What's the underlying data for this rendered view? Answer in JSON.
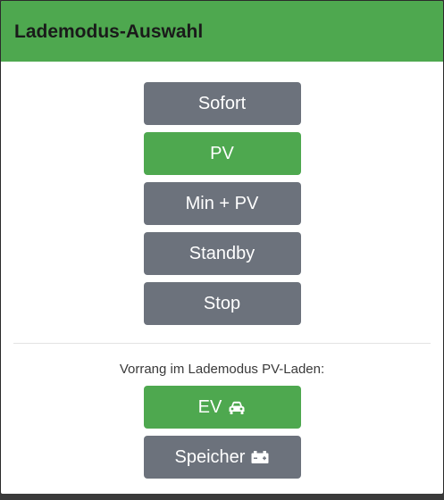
{
  "header": {
    "title": "Lademodus-Auswahl"
  },
  "modes": [
    {
      "label": "Sofort",
      "state": "inactive"
    },
    {
      "label": "PV",
      "state": "active"
    },
    {
      "label": "Min + PV",
      "state": "inactive"
    },
    {
      "label": "Standby",
      "state": "inactive"
    },
    {
      "label": "Stop",
      "state": "inactive"
    }
  ],
  "priority": {
    "label": "Vorrang im Lademodus PV-Laden:",
    "options": [
      {
        "label": "EV",
        "icon": "car-icon",
        "state": "active"
      },
      {
        "label": "Speicher",
        "icon": "battery-icon",
        "state": "inactive"
      }
    ]
  },
  "colors": {
    "accent_green": "#4ea84f",
    "inactive_gray": "#6c727c"
  }
}
